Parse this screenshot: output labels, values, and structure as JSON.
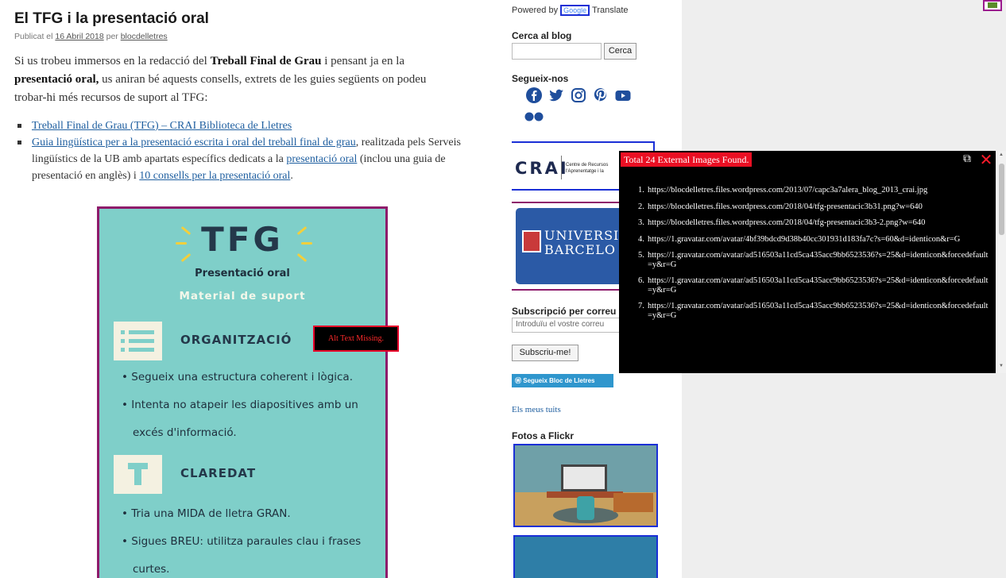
{
  "post": {
    "title": "El TFG i la presentació oral",
    "meta_prefix": "Publicat el ",
    "meta_date": "16 Abril 2018",
    "meta_mid": " per ",
    "meta_author": "blocdelletres",
    "intro_1": "Si us trobeu immersos en la redacció del ",
    "intro_bold_1": "Treball Final de Grau",
    "intro_2": " i pensant ja en la ",
    "intro_bold_2": "presentació oral,",
    "intro_3": " us aniran bé aquests consells, extrets de les guies següents on podeu trobar-hi més recursos de suport al TFG:",
    "link_1": "Treball Final de Grau (TFG) – CRAI Biblioteca de Lletres",
    "link_2": "Guia lingüística per a la presentació escrita i oral del treball final de grau",
    "link_2_after": ", realitzada pels Serveis lingüístics de la UB amb apartats específics dedicats a la ",
    "link_3": "presentació oral",
    "link_3_after": " (inclou una guia de presentació en anglès) i ",
    "link_4": "10 consells per la presentació oral",
    "link_4_after": "."
  },
  "poster": {
    "title": "TFG",
    "subtitle": "Presentació oral",
    "tagline": "Material de suport",
    "section_1": "ORGANITZACIÓ",
    "section_1_bullets": [
      "• Segueix una estructura coherent i lògica.",
      "• Intenta no atapeir les diapositives amb un",
      "excés d'informació."
    ],
    "section_2": "CLAREDAT",
    "section_2_bullets": [
      "• Tria una MIDA de lletra GRAN.",
      "• Sigues BREU: utilitza paraules clau i frases",
      "curtes."
    ]
  },
  "alt_warning": "Alt Text Missing.",
  "sidebar": {
    "powered_prefix": "Powered by ",
    "powered_google": "Google",
    "powered_suffix": " Translate",
    "search_heading": "Cerca al blog",
    "search_button": "Cerca",
    "follow_heading": "Segueix-nos",
    "crai_logo": "CRAI",
    "crai_text_1": "Centre de Recursos",
    "crai_text_2": "l'Aprenentatge i la",
    "ub_line_1": "UNIVERSIT",
    "ub_line_2": "BARCELO",
    "subscribe_heading": "Subscripció per correu",
    "subscribe_placeholder": "Introduïu el vostre correu",
    "subscribe_button": "Subscriu-me!",
    "follow_blog_button": "Segueix Bloc de Lletres",
    "tweets_link": "Els meus tuits",
    "flickr_heading": "Fotos a Flickr"
  },
  "panel": {
    "title": "Total 24 External Images Found.",
    "restore_icon": "⧉",
    "close_icon": "✕",
    "items": [
      {
        "n": "1.",
        "url": "https://blocdelletres.files.wordpress.com/2013/07/capc3a7alera_blog_2013_crai.jpg"
      },
      {
        "n": "2.",
        "url": "https://blocdelletres.files.wordpress.com/2018/04/tfg-presentacic3b31.png?w=640"
      },
      {
        "n": "3.",
        "url": "https://blocdelletres.files.wordpress.com/2018/04/tfg-presentacic3b3-2.png?w=640"
      },
      {
        "n": "4.",
        "url": "https://1.gravatar.com/avatar/4bf39bdcd9d38b40cc301931d183fa7c?s=60&d=identicon&r=G"
      },
      {
        "n": "5.",
        "url": "https://1.gravatar.com/avatar/ad516503a11cd5ca435acc9bb6523536?s=25&d=identicon&forcedefault=y&r=G"
      },
      {
        "n": "6.",
        "url": "https://1.gravatar.com/avatar/ad516503a11cd5ca435acc9bb6523536?s=25&d=identicon&forcedefault=y&r=G"
      },
      {
        "n": "7.",
        "url": "https://1.gravatar.com/avatar/ad516503a11cd5ca435acc9bb6523536?s=25&d=identicon&forcedefault=y&r=G"
      }
    ]
  },
  "colors": {
    "link": "#1f5fa0",
    "poster_bg": "#7fcfc9",
    "poster_border": "#8e1b6b",
    "panel_title_bg": "#ea0f23",
    "ub_blue": "#2b5aa6"
  }
}
